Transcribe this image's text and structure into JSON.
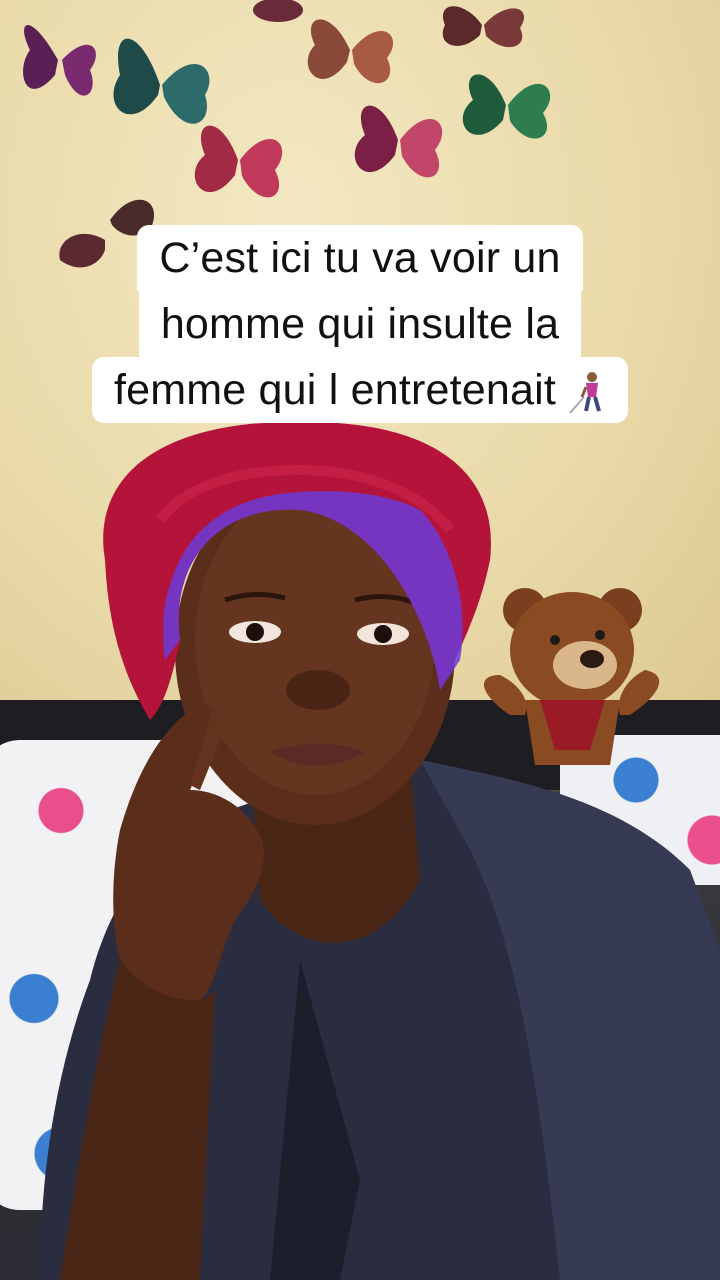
{
  "caption": {
    "line1": "C’est ici tu va voir un",
    "line2": "homme qui insulte la",
    "line3": "femme qui l entretenait"
  },
  "icons": {
    "caption_emoji": "woman-with-white-cane-icon"
  },
  "colors": {
    "caption_bg": "#ffffff",
    "caption_text": "#111111",
    "wall": "#ead9a6",
    "bonnet": "#b4143a",
    "bonnet_trim": "#6a3bd8",
    "robe": "#2a2c40"
  }
}
